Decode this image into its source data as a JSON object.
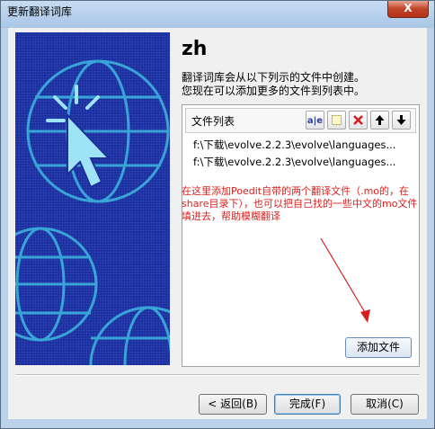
{
  "window": {
    "title": "更新翻译词库",
    "close_glyph": "X"
  },
  "heading": "zh",
  "description": [
    "翻译词库会从以下列示的文件中创建。",
    "您现在可以添加更多的文件到列表中。"
  ],
  "file_list": {
    "label": "文件列表",
    "tools": [
      "rename-icon",
      "new-icon",
      "delete-icon",
      "up-arrow-icon",
      "down-arrow-icon"
    ],
    "items": [
      "f:\\下载\\evolve.2.2.3\\evolve\\languages...",
      "f:\\下载\\evolve.2.2.3\\evolve\\languages..."
    ]
  },
  "annotation": "在这里添加Poedit自带的两个翻译文件（.mo的，在share目录下），也可以把自己找的一些中文的mo文件填进去，帮助模糊翻译",
  "add_file_button": "添加文件",
  "footer": {
    "back": "< 返回(B)",
    "finish": "完成(F)",
    "cancel": "取消(C)"
  },
  "colors": {
    "banner": "#1d2f9a",
    "annotation": "#e0201e",
    "arrow": "#d62020"
  }
}
